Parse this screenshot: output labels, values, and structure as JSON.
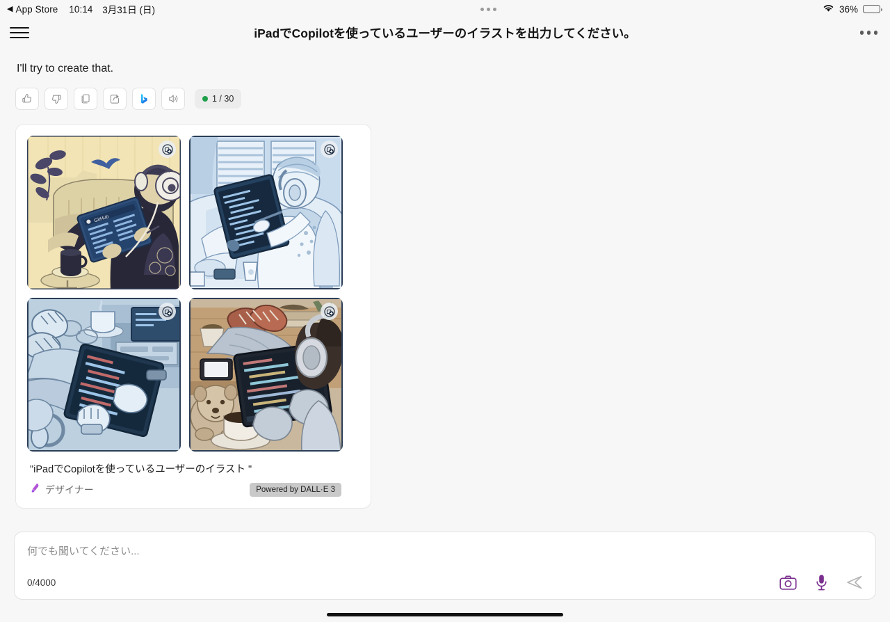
{
  "status_bar": {
    "back_arrow": "◀",
    "back_app": "App Store",
    "time": "10:14",
    "date": "3月31日 (日)",
    "battery_percent": "36%",
    "battery_level": 36,
    "wifi_icon": "wifi-icon",
    "battery_icon": "battery-icon"
  },
  "header": {
    "menu_icon": "hamburger-menu-icon",
    "title": "iPadでCopilotを使っているユーザーのイラストを出力してください。",
    "more_icon": "more-options-icon"
  },
  "message": {
    "answer_text": "I'll try to create that.",
    "actions": [
      {
        "name": "thumbs-up-icon",
        "label": "Like"
      },
      {
        "name": "thumbs-down-icon",
        "label": "Dislike"
      },
      {
        "name": "copy-icon",
        "label": "Copy"
      },
      {
        "name": "share-icon",
        "label": "Share"
      },
      {
        "name": "bing-logo-icon",
        "label": "Bing"
      },
      {
        "name": "speaker-icon",
        "label": "Read aloud"
      }
    ],
    "turn_counter": "1 / 30",
    "turn_counter_dot_color": "#1f9e4a"
  },
  "image_card": {
    "images": [
      {
        "alt": "person on couch using tablet with headphones, plant and coffee, sepia tone",
        "badge": "ai-generated-badge-icon"
      },
      {
        "alt": "person on couch using tablet with stylus near window blinds, blue tone",
        "badge": "ai-generated-badge-icon"
      },
      {
        "alt": "first person view of legs with tablet showing code on desk, blue-gray tone",
        "badge": "ai-generated-badge-icon"
      },
      {
        "alt": "person with headphones using tablet with code, dog and coffee on desk",
        "badge": "ai-generated-badge-icon"
      }
    ],
    "caption": "\"iPadでCopilotを使っているユーザーのイラスト \"",
    "designer_icon": "paintbrush-icon",
    "designer_label": "デザイナー",
    "powered_by": "Powered by DALL·E 3"
  },
  "composer": {
    "placeholder": "何でも聞いてください...",
    "char_count": "0/4000",
    "camera_icon": "camera-icon",
    "mic_icon": "microphone-icon",
    "send_icon": "send-icon",
    "accent_color": "#7a2f8f"
  }
}
